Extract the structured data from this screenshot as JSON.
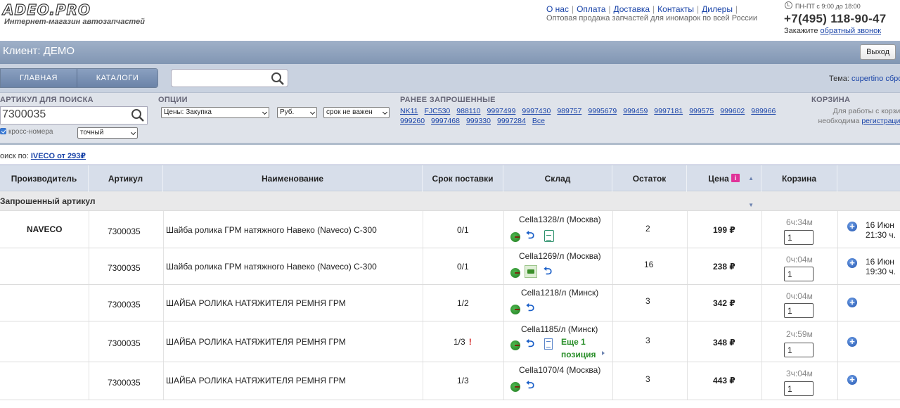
{
  "header": {
    "logo": "ADEO.PRO",
    "tagline": "Интернет-магазин автозапчастей",
    "links": [
      "О нас",
      "Оплата",
      "Доставка",
      "Контакты",
      "Дилеры"
    ],
    "subtitle": "Оптовая продажа запчастей для иномарок по всей России",
    "hours": "ПН-ПТ с 9:00 до 18:00",
    "phone": "+7(495) 118-90-47",
    "callback_prefix": "Закажите",
    "callback_link": "обратный звонок"
  },
  "client_bar": {
    "title": "Клиент: ДЕМО",
    "logout": "Выход"
  },
  "nav": {
    "main": "ГЛАВНАЯ",
    "catalogs": "КАТАЛОГИ",
    "search_value": "",
    "theme_label": "Тема:",
    "theme_value": "cupertino сбро"
  },
  "options": {
    "article_head": "АРТИКУЛ ДЛЯ ПОИСКА",
    "article_value": "7300035",
    "cross_label": "кросс-номера",
    "match_mode": "точный",
    "options_head": "ОПЦИИ",
    "price_select": "Цены: Закупка",
    "currency_select": "Руб.",
    "term_select": "срок не важен",
    "prev_head": "РАНЕЕ ЗАПРОШЕННЫЕ",
    "prev": [
      "NK11",
      "FJC530",
      "988110",
      "9997499",
      "9997430",
      "989757",
      "9995679",
      "999459",
      "9997181",
      "999575",
      "999602",
      "989966",
      "999260",
      "9997468",
      "999330",
      "9997284",
      "Все"
    ],
    "cart_head": "КОРЗИНА",
    "cart_note_1": "Для работы с корзин",
    "cart_note_2_prefix": "необходима",
    "cart_note_2_link": "регистрация"
  },
  "searchby": {
    "label": "оиск по:",
    "link": "IVECO от 293₽"
  },
  "table": {
    "headers": {
      "manufacturer": "Производитель",
      "article": "Артикул",
      "name": "Наименование",
      "delivery": "Срок поставки",
      "warehouse": "Склад",
      "stock": "Остаток",
      "price": "Цена",
      "price_info": "i",
      "cart": "Корзина"
    },
    "group_label": "Запрошенный артикул",
    "rows": [
      {
        "manufacturer": "NAVECO",
        "article": "7300035",
        "name": "Шайба ролика ГРМ натяжного Навеко (Naveco) C-300",
        "delivery": "0/1",
        "warehouse": "Cella1328/л (Москва)",
        "stock": "2",
        "price": "199 ₽",
        "timer": "6ч:34м",
        "qty": "1",
        "date": "16 Июн",
        "time": "21:30 ч."
      },
      {
        "manufacturer": "",
        "article": "7300035",
        "name": "Шайба ролика ГРМ натяжного Навеко (Naveco) C-300",
        "delivery": "0/1",
        "warehouse": "Cella1269/л (Москва)",
        "stock": "16",
        "price": "238 ₽",
        "timer": "0ч:04м",
        "qty": "1",
        "date": "16 Июн",
        "time": "19:30 ч."
      },
      {
        "manufacturer": "",
        "article": "7300035",
        "name": "ШАЙБА РОЛИКА НАТЯЖИТЕЛЯ РЕМНЯ ГРМ",
        "delivery": "1/2",
        "warehouse": "Cella1218/л (Минск)",
        "stock": "3",
        "price": "342 ₽",
        "timer": "0ч:04м",
        "qty": "1",
        "date": "",
        "time": ""
      },
      {
        "manufacturer": "",
        "article": "7300035",
        "name": "ШАЙБА РОЛИКА НАТЯЖИТЕЛЯ РЕМНЯ ГРМ",
        "delivery": "1/3",
        "warning": "!",
        "warehouse": "Cella1185/л (Минск)",
        "more_1": "Еще 1",
        "more_2": "позиция",
        "stock": "3",
        "price": "348 ₽",
        "timer": "2ч:59м",
        "qty": "1",
        "date": "",
        "time": ""
      },
      {
        "manufacturer": "",
        "article": "7300035",
        "name": "ШАЙБА РОЛИКА НАТЯЖИТЕЛЯ РЕМНЯ ГРМ",
        "delivery": "1/3",
        "warehouse": "Cella1070/4 (Москва)",
        "stock": "3",
        "price": "443 ₽",
        "timer": "3ч:04м",
        "qty": "1",
        "date": "",
        "time": ""
      }
    ]
  },
  "colors": {
    "header_bar": "#8fa3bf",
    "table_header": "#d7deea",
    "link": "#1a44a8",
    "accent_green": "#2a8f2a"
  }
}
